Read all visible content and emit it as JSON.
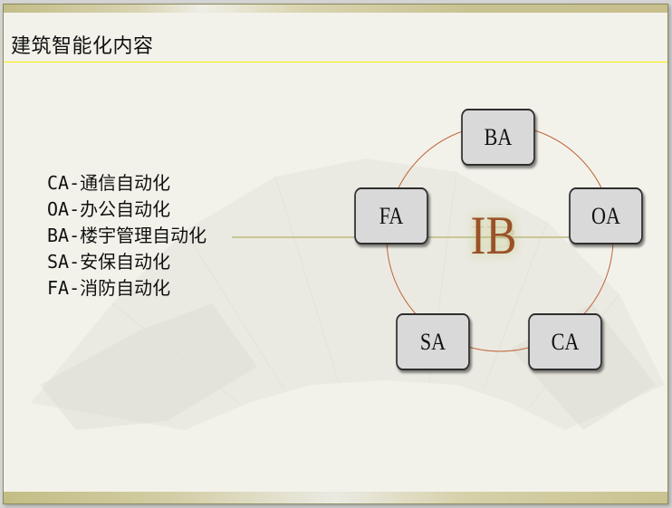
{
  "slide": {
    "title": "建筑智能化内容",
    "list_items": [
      "CA-通信自动化",
      "OA-办公自动化",
      "BA-楼宇管理自动化",
      "SA-安保自动化",
      "FA-消防自动化"
    ],
    "diagram": {
      "center_label": "IB",
      "nodes": [
        {
          "id": "ba",
          "label": "BA"
        },
        {
          "id": "oa",
          "label": "OA"
        },
        {
          "id": "ca",
          "label": "CA"
        },
        {
          "id": "sa",
          "label": "SA"
        },
        {
          "id": "fa",
          "label": "FA"
        }
      ],
      "colors": {
        "ring": "#c0643a",
        "center_text": "#9b5228",
        "connector": "#c9c598",
        "node_fill": "#d9d9d9"
      }
    },
    "colors": {
      "title_rule": "#f5f000",
      "band": "#c7c08d",
      "background": "#f3f2ea"
    }
  }
}
